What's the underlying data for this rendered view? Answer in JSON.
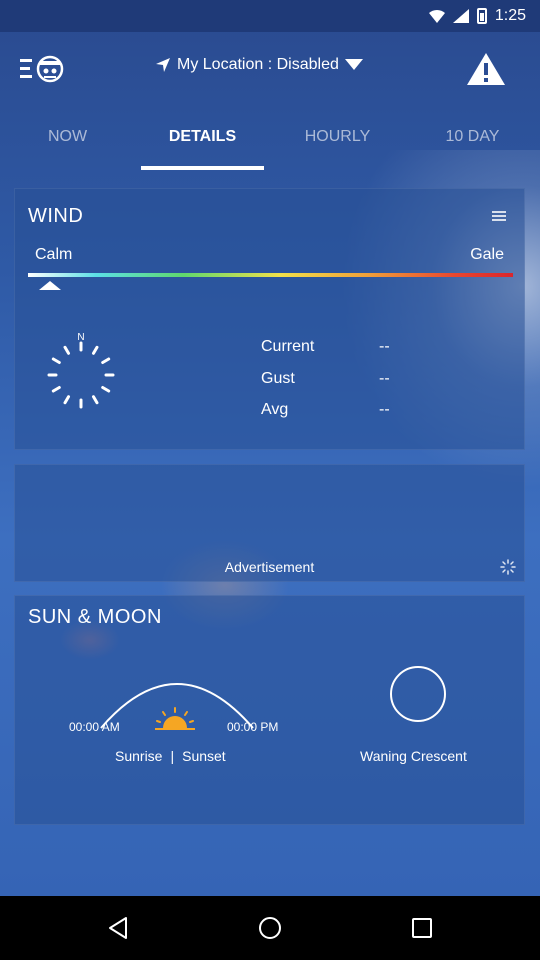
{
  "status": {
    "time": "1:25"
  },
  "header": {
    "location_label": "My Location : Disabled",
    "menu_icon": "menu-logo-icon",
    "warning_icon": "warning-icon"
  },
  "tabs": [
    {
      "label": "NOW",
      "active": false
    },
    {
      "label": "DETAILS",
      "active": true
    },
    {
      "label": "HOURLY",
      "active": false
    },
    {
      "label": "10 DAY",
      "active": false
    }
  ],
  "wind": {
    "title": "WIND",
    "scale_min_label": "Calm",
    "scale_max_label": "Gale",
    "compass_north": "N",
    "stats": [
      {
        "label": "Current",
        "value": "--"
      },
      {
        "label": "Gust",
        "value": "--"
      },
      {
        "label": "Avg",
        "value": "--"
      }
    ]
  },
  "ad": {
    "label": "Advertisement"
  },
  "sun_moon": {
    "title": "SUN & MOON",
    "sunrise_time": "00:00 AM",
    "sunset_time": "00:00 PM",
    "sunrise_label": "Sunrise",
    "separator": "|",
    "sunset_label": "Sunset",
    "moon_phase": "Waning Crescent"
  },
  "colors": {
    "accent": "#ffffff",
    "sun": "#f5a623"
  }
}
